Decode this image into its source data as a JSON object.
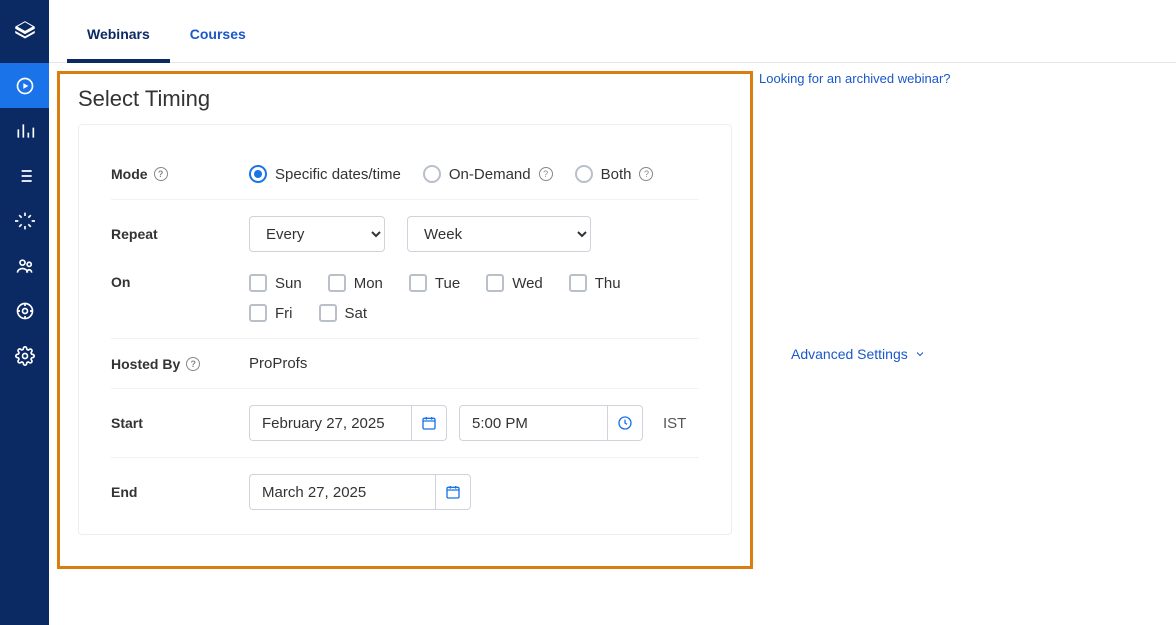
{
  "tabs": {
    "webinars": "Webinars",
    "courses": "Courses"
  },
  "section_title": "Select Timing",
  "right_link": "Looking for an archived webinar?",
  "labels": {
    "mode": "Mode",
    "repeat": "Repeat",
    "on": "On",
    "hosted_by": "Hosted By",
    "start": "Start",
    "end": "End"
  },
  "mode_options": {
    "specific": "Specific dates/time",
    "on_demand": "On-Demand",
    "both": "Both"
  },
  "repeat": {
    "freq": "Every",
    "unit": "Week"
  },
  "days": {
    "sun": "Sun",
    "mon": "Mon",
    "tue": "Tue",
    "wed": "Wed",
    "thu": "Thu",
    "fri": "Fri",
    "sat": "Sat"
  },
  "hosted_by_value": "ProProfs",
  "start": {
    "date": "February 27, 2025",
    "time": "5:00 PM",
    "tz": "IST"
  },
  "end": {
    "date": "March 27, 2025"
  },
  "advanced_label": "Advanced Settings"
}
